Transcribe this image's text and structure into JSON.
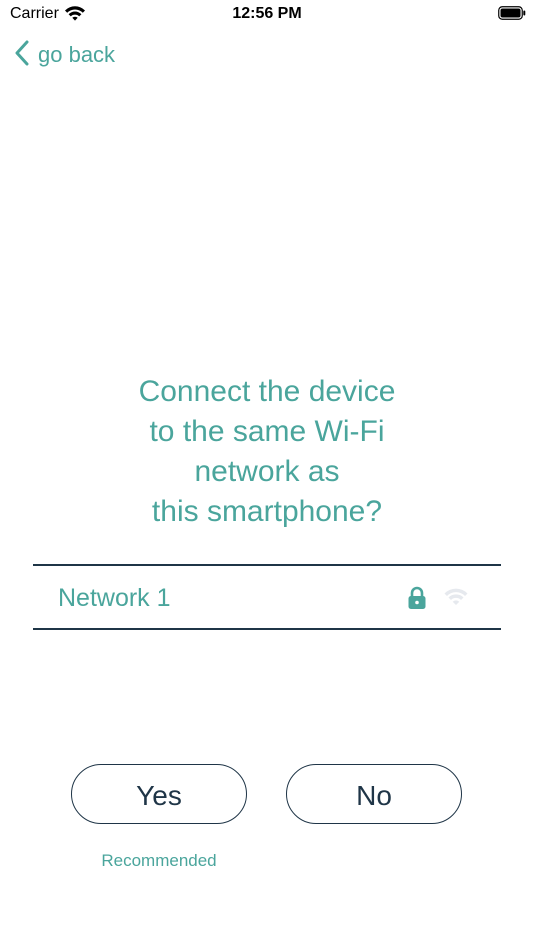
{
  "status_bar": {
    "carrier": "Carrier",
    "time": "12:56 PM",
    "wifi_icon": "wifi-icon",
    "battery_icon": "battery-icon"
  },
  "nav": {
    "back_label": "go back",
    "back_icon": "chevron-left-icon"
  },
  "question": {
    "lines": [
      "Connect the device",
      "to the same Wi-Fi",
      "network as",
      "this smartphone?"
    ]
  },
  "network": {
    "name": "Network 1",
    "lock_icon": "lock-icon",
    "signal_icon": "wifi-signal-icon"
  },
  "buttons": {
    "yes_label": "Yes",
    "no_label": "No",
    "recommended_label": "Recommended"
  },
  "colors": {
    "accent": "#4aa59c",
    "dark": "#1f3547",
    "background": "#ffffff"
  }
}
